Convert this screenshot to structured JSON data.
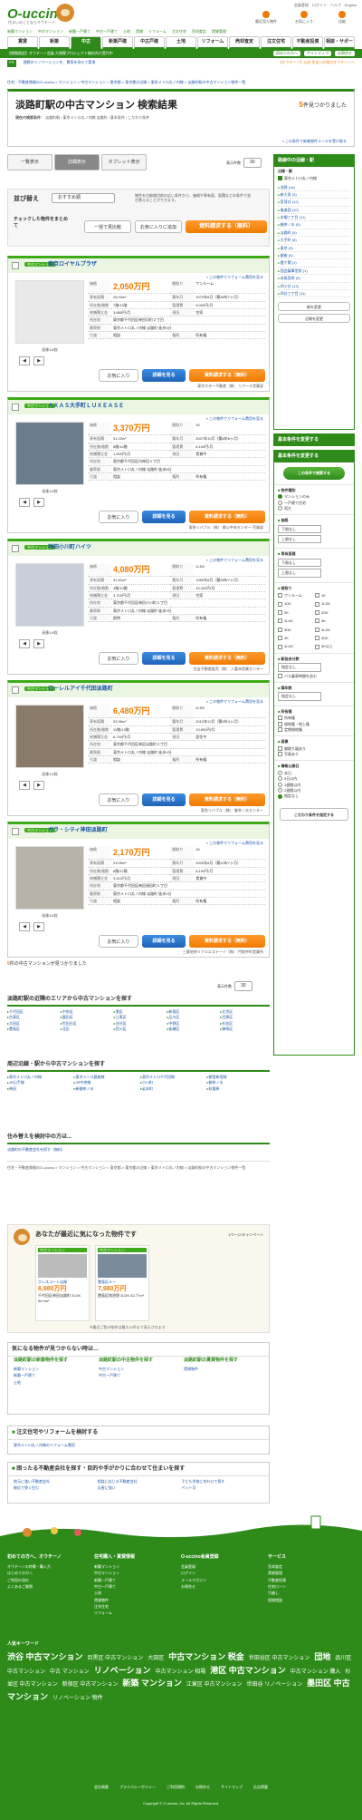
{
  "header": {
    "logo": "O-uccino",
    "logo_sub": "住まいのことならオウチーノ",
    "links": [
      "会員登録",
      "ログイン",
      "ヘルプ",
      "English"
    ],
    "icons": [
      {
        "label": "最近見た物件",
        "icon": "clock-icon"
      },
      {
        "label": "お気に入り",
        "icon": "heart-icon"
      },
      {
        "label": "比較",
        "icon": "compare-icon"
      }
    ]
  },
  "subnav": [
    "新築マンション",
    "中古マンション",
    "新築一戸建て",
    "中古一戸建て",
    "土地",
    "賃貸",
    "リフォーム",
    "注文住宅",
    "売却査定",
    "賃貸管理"
  ],
  "gnav": [
    "賃貸",
    "新築",
    "中古",
    "新築戸建",
    "中古戸建",
    "土地",
    "リフォーム",
    "売却査定",
    "注文住宅",
    "不動産投資",
    "相談・サポート"
  ],
  "gnav_active": 2,
  "gbar": {
    "left": "【期間限定】オウチーノ会員 大規模プロジェクト無料先行受付中",
    "right": [
      "初めての方へ",
      "サイトマップ",
      "お問合せ"
    ]
  },
  "notice": {
    "tag": "PR",
    "text": "理想のリノベーションを、費用を抑えて実現",
    "right": "【オウチーノ】公式 住まいの窓口オウチーノへ"
  },
  "breadcrumbs": "住宅・不動産情報のO-uccino > マンション > 中古マンション > 東京都 > 東京都の沿線 > 東京メトロ丸ノ内線 > 淡路町駅の中古マンション物件一覧",
  "title": {
    "heading": "淡路町駅の中古マンション 検索結果",
    "count": "5",
    "count_suffix": "件見つかりました",
    "cond_label": "現在の検索条件",
    "cond": "淡路町駅 / 東京メトロ丸ノ内線 淡路町 / 基本条件 / こだわり条件",
    "notify": "» この条件で新着物件メールを受け取る"
  },
  "view_tabs": [
    "一覧表示",
    "詳細表示",
    "タブレット表示"
  ],
  "perpage": {
    "label": "表示件数",
    "value": "30"
  },
  "refine": {
    "label": "並び替え",
    "sort": "おすすめ順",
    "note": "物件を比較検討前の広い条件から、価格や専有面、面積などの条件で並び替えることができます。",
    "check_label": "チェックした物件をまとめて",
    "b1": "一括で見比較",
    "b2": "お気に入りに追加",
    "b3": "資料請求する（無料）"
  },
  "listings": [
    {
      "name": "東京ロイヤルプラザ",
      "price": "2,050万円",
      "layout": "ワンルーム",
      "area": "25.03m²",
      "built": "1979年8月（築36年7ヶ月）",
      "floor": "7階/11階",
      "address": "東京都千代田区神田司町２丁目",
      "access": "東京メトロ丸ノ内線 淡路町 徒歩3分",
      "mgmt": "9,000円/月",
      "repair": "3,680円/月",
      "status": "空家",
      "delivery": "相談",
      "rights": "所有権",
      "agent": "東京スター不動産（株） リアール営業部",
      "photo_caption": "画像1/6枚"
    },
    {
      "name": "ＡＸＡＳ大手町ＬＵＸＥＡＳＥ",
      "price": "3,370万円",
      "layout": "1K",
      "area": "31.22m²",
      "built": "2007年10月（築8年6ヶ月）",
      "floor": "8階/14階",
      "address": "東京都千代田区内神田１丁目",
      "access": "東京メトロ丸ノ内線 淡路町 徒歩5分",
      "mgmt": "8,100円/月",
      "repair": "1,900円/月",
      "status": "賃貸中",
      "delivery": "相談",
      "rights": "所有権",
      "agent": "東急リバブル（株） 都心中央センター 売買部",
      "photo_caption": "画像1/6枚"
    },
    {
      "name": "神田小川町ハイツ",
      "price": "4,080万円",
      "layout": "1LDK",
      "area": "31.61m²",
      "built": "1980年8月（築35年7ヶ月）",
      "floor": "4階/10階",
      "address": "東京都千代田区神田小川町１丁目",
      "access": "東京メトロ丸ノ内線 淡路町 徒歩2分",
      "mgmt": "15,400円/月",
      "repair": "3,700円/月",
      "status": "空家",
      "delivery": "即時",
      "rights": "所有権",
      "agent": "住友不動産販売（株） 八重洲営業センター",
      "photo_caption": "画像1/6枚"
    },
    {
      "name": "ローレルアイ千代田淡路町",
      "price": "6,480万円",
      "layout": "2LDK",
      "area": "53.98m²",
      "built": "2010年12月（築5年4ヶ月）",
      "floor": "11階/13階",
      "address": "東京都千代田区神田淡路町２丁目",
      "access": "東京メトロ丸ノ内線 淡路町 徒歩1分",
      "mgmt": "13,800円/月",
      "repair": "6,740円/月",
      "status": "居住中",
      "delivery": "相談",
      "rights": "所有権",
      "agent": "東急リバブル（株） 御茶ノ水センター",
      "photo_caption": "画像1/6枚"
    },
    {
      "name": "ガラ・シティ神田淡路町",
      "price": "2,170万円",
      "layout": "1K",
      "area": "23.05m²",
      "built": "2005年8月（築10年7ヶ月）",
      "floor": "8階/12階",
      "address": "東京都千代田区神田須田町１丁目",
      "access": "東京メトロ丸ノ内線 淡路町 徒歩2分",
      "mgmt": "8,100円/月",
      "repair": "3,410円/月",
      "status": "賃貸中",
      "delivery": "相談",
      "rights": "所有権",
      "agent": "三菱地所リアルエステート（株） 門前仲町営業所",
      "photo_caption": "画像1/6枚"
    }
  ],
  "labels": {
    "price": "価格",
    "layout": "間取り",
    "area": "専有面積",
    "built": "築年月",
    "floor": "所在階/階数",
    "address": "所在地",
    "access": "最寄駅",
    "mgmt": "管理費",
    "repair": "修繕積立金",
    "status": "現況",
    "delivery": "引渡",
    "rights": "権利",
    "new_badge": "中古マンション",
    "renov": "» この物件でリフォーム費用を見る",
    "fav": "お気に入り",
    "detail": "詳細を見る",
    "request": "資料請求する（無料）"
  },
  "result_footer": {
    "count": "5",
    "text": "件の中古マンションが見つかりました"
  },
  "nearby_areas": {
    "title": "淡路町駅の近隣のエリアから中古マンションを探す",
    "items": [
      "千代田区",
      "中央区",
      "港区",
      "新宿区",
      "文京区",
      "台東区",
      "墨田区",
      "江東区",
      "品川区",
      "目黒区",
      "大田区",
      "世田谷区",
      "渋谷区",
      "中野区",
      "杉並区",
      "豊島区",
      "北区",
      "荒川区",
      "板橋区",
      "練馬区"
    ]
  },
  "nearby_stations": {
    "title": "周辺沿線・駅から中古マンションを探す",
    "items": [
      "東京メトロ丸ノ内線",
      "東京メトロ銀座線",
      "東京メトロ千代田線",
      "都営新宿線",
      "JR山手線",
      "JR中央線",
      "小川町",
      "御茶ノ水",
      "神田",
      "新御茶ノ水",
      "岩本町",
      "秋葉原"
    ]
  },
  "lifestyle": {
    "title": "住み替えを検討中の方は...",
    "link": "淡路町の不動産会社を探す（無料）"
  },
  "recent": {
    "title": "あなたが最近に気になった物件です",
    "pager": "1ページ/キャンペーン",
    "cards": [
      {
        "label": "中古マンション",
        "name": "グレスコート淡路",
        "price": "6,980万円",
        "detail": "千代田区神田淡路町 2LDK 56.9m²"
      },
      {
        "label": "中古マンション",
        "name": "豊島区ルー",
        "price": "7,980万円",
        "detail": "豊島区南池袋 3LDK 82.77m²"
      }
    ],
    "note": "※最近ご覧の物件は最大10件まで表示されます"
  },
  "notfound": {
    "title": "気になる物件が見つからない時は…",
    "cols": [
      {
        "head": "淡路町駅の新築物件を探す",
        "items": [
          "新築マンション",
          "新築一戸建て",
          "土地"
        ]
      },
      {
        "head": "淡路町駅の中古物件を探す",
        "items": [
          "中古マンション",
          "中古一戸建て"
        ]
      },
      {
        "head": "淡路町駅の賃貸物件を探す",
        "items": [
          "賃貸物件"
        ]
      }
    ]
  },
  "reform": {
    "title": "注文住宅やリフォームを検討する",
    "link": "東京メトロ丸ノ内線のリフォーム費用"
  },
  "help": {
    "title": "困ったる不動産会社を探す・目的や手がかりに合わせて住まいを探す",
    "items": [
      "地元に強い不動産会社",
      "相談に応じる不動産会社",
      "子ども学校に合わせて探す",
      "駅近で狭く住む",
      "災害に強い",
      "ペット可"
    ]
  },
  "footer": {
    "cols": [
      {
        "head": "初めての方へ、オウチーノ",
        "items": [
          "オウチーノの特徴・購入力",
          "はじめての方へ",
          "ご利用の流れ",
          "よくあるご質問"
        ]
      },
      {
        "head": "住宅購入・賃貸情報",
        "items": [
          "新築マンション",
          "中古マンション",
          "新築一戸建て",
          "中古一戸建て",
          "土地",
          "賃貸物件",
          "注文住宅",
          "リフォーム"
        ]
      },
      {
        "head": "O-uccino会員登録",
        "items": [
          "会員登録",
          "ログイン",
          "メールマガジン",
          "お問合せ"
        ]
      },
      {
        "head": "サービス",
        "items": [
          "売却査定",
          "賃貸管理",
          "不動産投資",
          "住宅ローン",
          "引越し",
          "保険相談"
        ]
      }
    ],
    "tags_head": "人気キーワード",
    "tags": [
      {
        "t": "渋谷 中古マンション",
        "b": true
      },
      {
        "t": "目黒区 中古マンション",
        "b": false
      },
      {
        "t": "大田区",
        "b": false
      },
      {
        "t": "中古マンション 税金",
        "b": true
      },
      {
        "t": "世田谷区 中古マンション",
        "b": false
      },
      {
        "t": "団地",
        "b": true
      },
      {
        "t": "品川区 中古マンション",
        "b": false
      },
      {
        "t": "中古 マンション",
        "b": false
      },
      {
        "t": "リノベーション",
        "b": true
      },
      {
        "t": "中古マンション 相場",
        "b": false
      },
      {
        "t": "港区 中古マンション",
        "b": true
      },
      {
        "t": "中古マンション 購入",
        "b": false
      },
      {
        "t": "杉並区 中古マンション",
        "b": false
      },
      {
        "t": "新宿区 中古マンション",
        "b": false
      },
      {
        "t": "新築 マンション",
        "b": true
      },
      {
        "t": "江東区 中古マンション",
        "b": false
      },
      {
        "t": "世田谷 リノベーション",
        "b": false
      },
      {
        "t": "墨田区 中古マンション",
        "b": true
      },
      {
        "t": "リノベーション 物件",
        "b": false
      }
    ],
    "nav": [
      "会社概要",
      "プライバシーポリシー",
      "ご利用規約",
      "お問合せ",
      "サイトマップ",
      "広告掲載"
    ],
    "copy": "Copyright © O-uccino, Inc. All Rights Reserved."
  },
  "side": {
    "area_title": "路線中の沿線・駅",
    "area_sub": "沿線・駅",
    "line": "東京メトロ丸ノ内線",
    "stations": [
      "池袋 (14)",
      "新大塚 (4)",
      "茗荷谷 (12)",
      "後楽園 (10)",
      "本郷三丁目 (11)",
      "御茶ノ水 (5)",
      "淡路町 (5)",
      "大手町 (8)",
      "東京 (3)",
      "銀座 (6)",
      "霞ケ関 (1)",
      "国会議事堂前 (1)",
      "赤坂見附 (9)",
      "四ツ谷 (13)",
      "四谷三丁目 (11)"
    ],
    "btn_station": "駅を変更",
    "btn_line": "沿線を変更",
    "cond_title": "基本条件を変更する",
    "cond_btn": "この条件で検索する",
    "types_head": "物件種別",
    "types": [
      "マンションのみ",
      "一戸建て住宅",
      "両方"
    ],
    "price_head": "価格",
    "price_from": "下限なし",
    "price_to": "上限なし",
    "area_head": "専有面積",
    "area_from": "下限なし",
    "area_to": "上限なし",
    "layout_head": "間取り",
    "layouts": [
      "ワンルーム",
      "1K",
      "1DK",
      "1LDK",
      "2K",
      "2DK",
      "2LDK",
      "3K",
      "3DK",
      "3LDK",
      "4K",
      "4DK",
      "4LDK",
      "5K以上"
    ],
    "walk_head": "駅徒歩分数",
    "walk_sel": "指定なし",
    "walk_opt": "バス乗車時間を含む",
    "age_head": "築年数",
    "age_sel": "指定なし",
    "own_head": "所有権",
    "own": [
      "所有権",
      "借地権・地上権",
      "定期借地権"
    ],
    "img_head": "画像",
    "img": [
      "間取り図あり",
      "写真あり"
    ],
    "info_head": "情報公開日",
    "info": [
      "本日",
      "3日以内",
      "1週間以内",
      "2週間以内",
      "指定なし"
    ],
    "info_on": 4,
    "detail_btn": "こだわり条件を指定する"
  }
}
